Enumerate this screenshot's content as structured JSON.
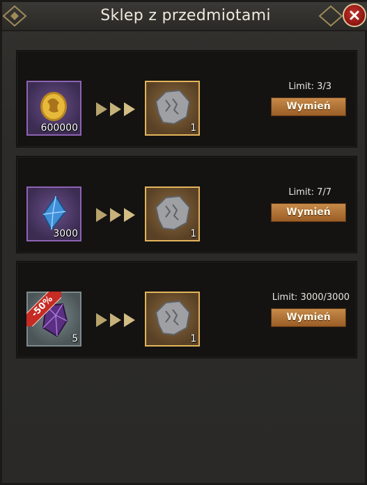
{
  "window": {
    "title": "Sklep z przedmiotami"
  },
  "rows": [
    {
      "input": {
        "icon": "gold-dragon-coin-icon",
        "count": "600000"
      },
      "output": {
        "icon": "stone-rune-icon",
        "count": "1"
      },
      "limit": "Limit: 3/3",
      "button": "Wymień"
    },
    {
      "input": {
        "icon": "blue-crystal-icon",
        "count": "3000"
      },
      "output": {
        "icon": "stone-rune-icon",
        "count": "1"
      },
      "limit": "Limit: 7/7",
      "button": "Wymień"
    },
    {
      "input": {
        "icon": "purple-gem-icon",
        "count": "5",
        "discount": "-50%"
      },
      "output": {
        "icon": "stone-rune-icon",
        "count": "1"
      },
      "limit": "Limit: 3000/3000",
      "button": "Wymień"
    }
  ],
  "colors": {
    "accent_gold": "#e3b55b",
    "button": "#b5733a",
    "close": "#b12620"
  }
}
